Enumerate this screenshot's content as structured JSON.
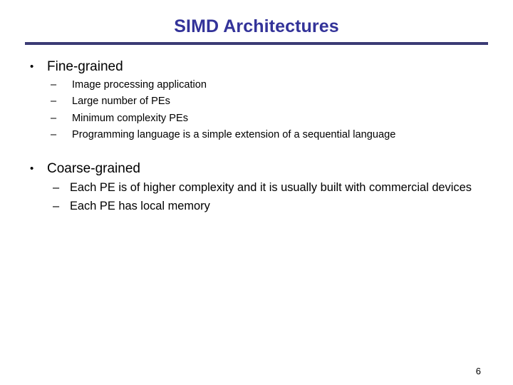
{
  "slide": {
    "title": "SIMD Architectures",
    "page_number": "6",
    "accent_color": "#333399",
    "rule_color": "#3b3b75",
    "text_color": "#000000",
    "background_color": "#ffffff",
    "bullet_marker": "•",
    "dash_marker": "–",
    "sections": [
      {
        "heading": "Fine-grained",
        "items": [
          "Image processing application",
          "Large number of PEs",
          "Minimum complexity PEs",
          "Programming language is a simple extension of a sequential language"
        ]
      },
      {
        "heading": "Coarse-grained",
        "items": [
          "Each PE is of higher complexity and it is usually built with commercial devices",
          "Each PE has local memory"
        ]
      }
    ]
  }
}
